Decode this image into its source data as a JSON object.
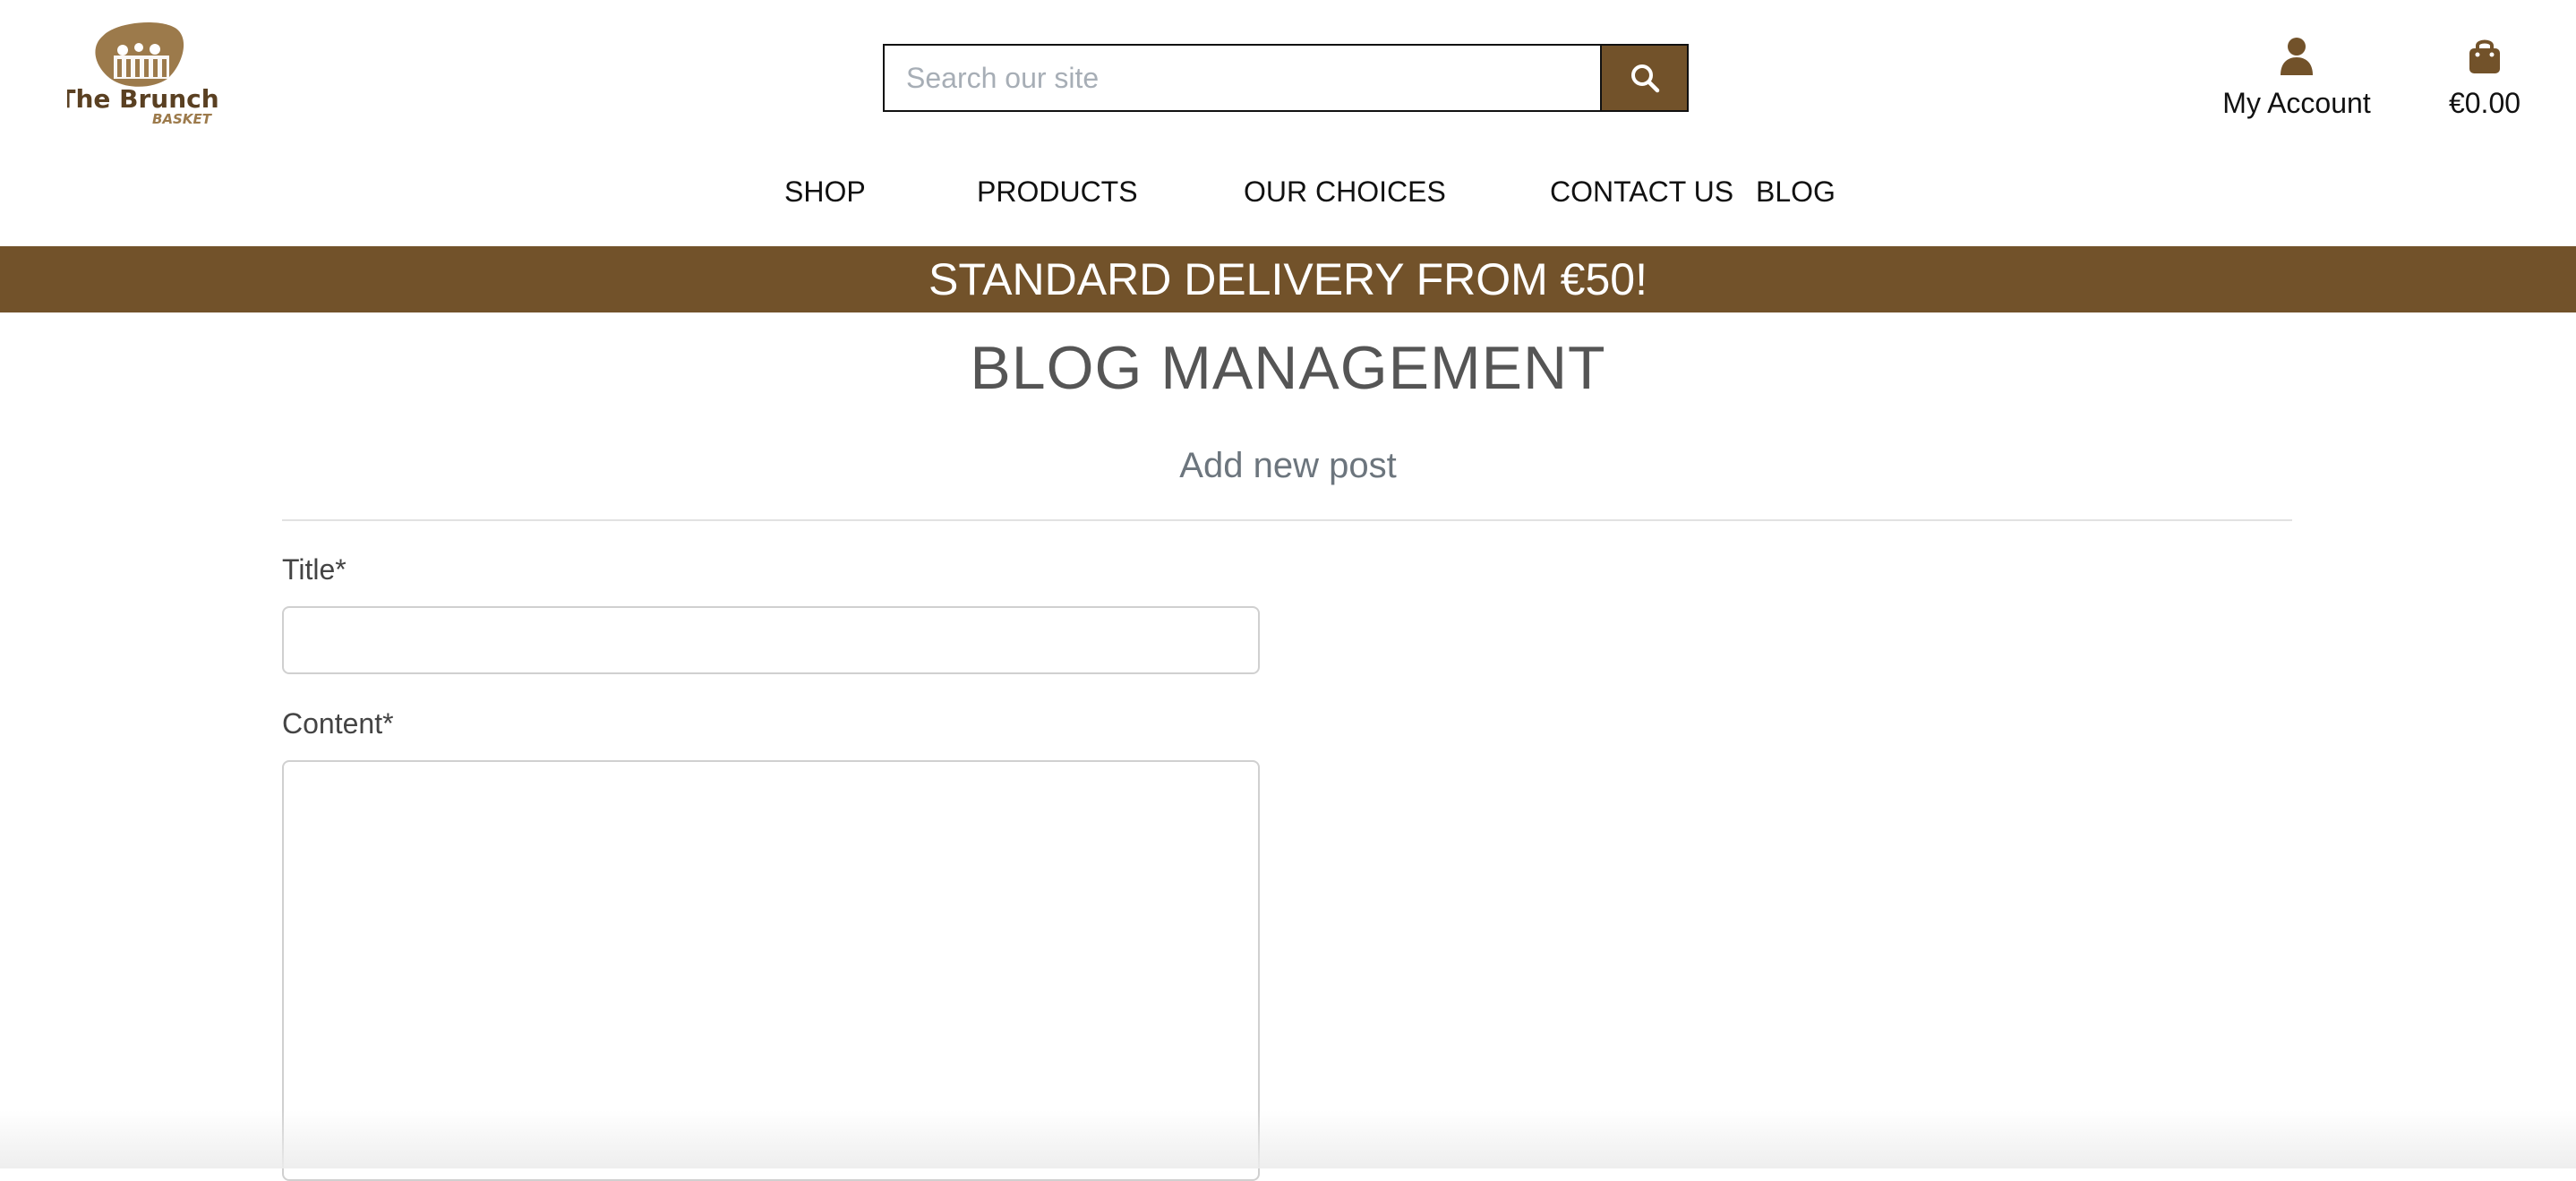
{
  "brand": {
    "logo_line1": "The Brunch",
    "logo_line2": "BASKET"
  },
  "search": {
    "placeholder": "Search our site"
  },
  "header": {
    "account_label": "My Account",
    "bag_total": "€0.00"
  },
  "nav": {
    "items": [
      "SHOP",
      "PRODUCTS",
      "OUR CHOICES",
      "CONTACT US",
      "BLOG"
    ]
  },
  "banner": {
    "text": "STANDARD DELIVERY FROM €50!"
  },
  "page": {
    "title": "BLOG MANAGEMENT",
    "subtitle": "Add new post"
  },
  "form": {
    "title_label": "Title*",
    "title_value": "",
    "content_label": "Content*",
    "content_value": ""
  },
  "colors": {
    "brand": "#72522a",
    "banner_text": "#ffffff"
  },
  "icons": [
    "logo",
    "search-icon",
    "user-icon",
    "shopping-bag-icon"
  ]
}
